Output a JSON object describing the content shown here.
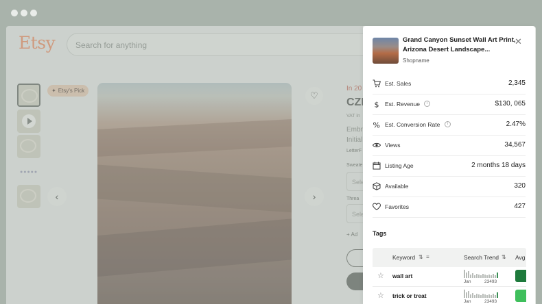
{
  "browser": {
    "dots": 3
  },
  "page": {
    "logo": "Etsy",
    "search_placeholder": "Search for anything",
    "badge": "Etsy's Pick",
    "right_lines": [
      "In 20",
      "CZI",
      "VAT in",
      "Embro",
      "Initial",
      "LetterF",
      "Sweate",
      "Sele",
      "Threa",
      "Sele",
      "+ Ad"
    ]
  },
  "panel": {
    "title": "Grand Canyon Sunset Wall Art Print, Arizona Desert Landscape...",
    "shop": "Shopname",
    "metrics": [
      {
        "label": "Est. Sales",
        "value": "2,345",
        "icon": "cart-icon",
        "info": false
      },
      {
        "label": "Est. Revenue",
        "value": "$130, 065",
        "icon": "dollar-icon",
        "info": true
      },
      {
        "label": "Est. Conversion Rate",
        "value": "2.47%",
        "icon": "percent-icon",
        "info": true
      },
      {
        "label": "Views",
        "value": "34,567",
        "icon": "eye-icon",
        "info": false
      },
      {
        "label": "Listing Age",
        "value": "2 months 18 days",
        "icon": "calendar-icon",
        "info": false
      },
      {
        "label": "Available",
        "value": "320",
        "icon": "box-icon",
        "info": false
      },
      {
        "label": "Favorites",
        "value": "427",
        "icon": "heart-icon",
        "info": false
      }
    ],
    "tags_title": "Tags",
    "columns": {
      "keyword": "Keyword",
      "trend": "Search Trend",
      "avg": "Avg"
    },
    "tags": [
      {
        "keyword": "wall art",
        "month": "Jan",
        "count": "23493",
        "color": "#1e7a3c"
      },
      {
        "keyword": "trick or treat",
        "month": "Jan",
        "count": "23493",
        "color": "#3fbf5c"
      }
    ]
  },
  "colors": {
    "accent": "#e8926a",
    "green_dark": "#1e7a3c",
    "green_light": "#3fbf5c"
  }
}
